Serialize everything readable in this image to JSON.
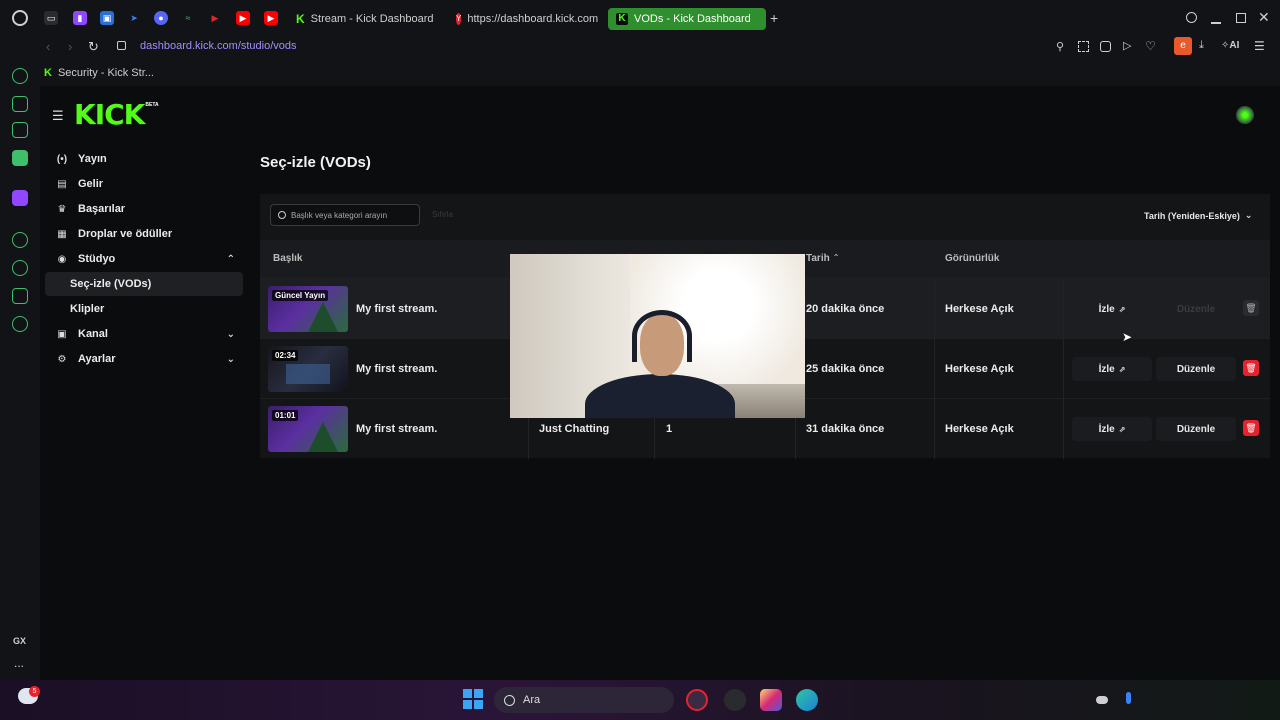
{
  "browser": {
    "tabs": [
      {
        "label": "Stream - Kick Dashboard",
        "active": false
      },
      {
        "label": "https://dashboard.kick.com",
        "active": false
      },
      {
        "label": "VODs - Kick Dashboard",
        "active": true
      }
    ],
    "new_tab": "+",
    "address": "dashboard.kick.com/studio/vods",
    "bookmark": "Security - Kick Str...",
    "ai_label": "AI",
    "profile_letter": "e",
    "gx_label": "GX",
    "more_label": "..."
  },
  "brand": {
    "logo": "KICK",
    "beta": "BETA"
  },
  "sidebar": {
    "items": [
      {
        "label": "Yayın",
        "icon": "broadcast-icon"
      },
      {
        "label": "Gelir",
        "icon": "money-icon"
      },
      {
        "label": "Başarılar",
        "icon": "trophy-icon"
      },
      {
        "label": "Droplar ve ödüller",
        "icon": "gift-icon"
      },
      {
        "label": "Stüdyo",
        "icon": "studio-icon"
      },
      {
        "label": "Kanal",
        "icon": "channel-icon"
      },
      {
        "label": "Ayarlar",
        "icon": "gear-icon"
      }
    ],
    "sub": [
      {
        "label": "Seç-izle (VODs)",
        "active": true
      },
      {
        "label": "Klipler",
        "active": false
      }
    ]
  },
  "main": {
    "title": "Seç-izle (VODs)",
    "search_placeholder": "Başlık veya kategori arayın",
    "clear": "Sıfırla",
    "sort": "Tarih (Yeniden-Eskiye)",
    "columns": {
      "title": "Başlık",
      "date": "Tarih",
      "visibility": "Görünürlük"
    },
    "rows": [
      {
        "badge": "Güncel Yayın",
        "title": "My first stream.",
        "category": "",
        "views": "",
        "date": "20 dakika önce",
        "visibility": "Herkese Açık",
        "watch": "İzle",
        "edit": "Düzenle",
        "edit_disabled": true
      },
      {
        "badge": "02:34",
        "title": "My first stream.",
        "category": "",
        "views": "",
        "date": "25 dakika önce",
        "visibility": "Herkese Açık",
        "watch": "İzle",
        "edit": "Düzenle",
        "edit_disabled": false
      },
      {
        "badge": "01:01",
        "title": "My first stream.",
        "category": "Just Chatting",
        "views": "1",
        "date": "31 dakika önce",
        "visibility": "Herkese Açık",
        "watch": "İzle",
        "edit": "Düzenle",
        "edit_disabled": false
      }
    ]
  },
  "taskbar": {
    "search": "Ara",
    "notification_count": "5"
  },
  "colors": {
    "kick_green": "#53fc18",
    "delete_red": "#e8222c",
    "active_tab": "#2f8f2f"
  }
}
